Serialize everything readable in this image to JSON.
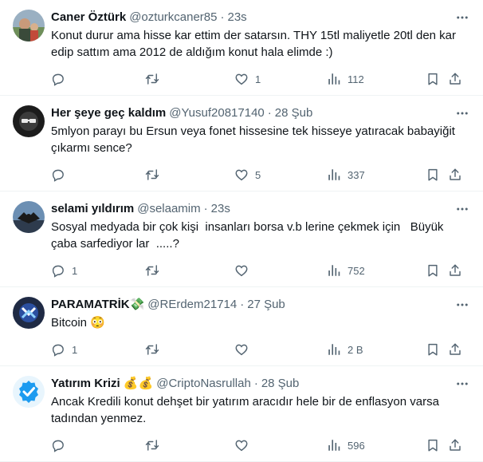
{
  "tweets": [
    {
      "name": "Caner Öztürk",
      "handle": "@ozturkcaner85",
      "dot": "·",
      "time": "23s",
      "text": "Konut durur ama hisse kar ettim der satarsın. THY 15tl maliyetle 20tl den kar edip sattım ama 2012 de aldığım konut hala elimde :)",
      "replies": "",
      "retweets": "",
      "likes": "1",
      "views": "112"
    },
    {
      "name": "Her şeye geç kaldım",
      "handle": "@Yusuf20817140",
      "dot": "·",
      "time": "28 Şub",
      "text": "5mlyon parayı bu Ersun veya fonet hissesine tek hisseye yatıracak babayiğit çıkarmı sence?",
      "replies": "",
      "retweets": "",
      "likes": "5",
      "views": "337"
    },
    {
      "name": "selami yıldırım",
      "handle": "@selaamim",
      "dot": "·",
      "time": "23s",
      "text": "Sosyal medyada bir çok kişi  insanları borsa v.b lerine çekmek için   Büyük çaba sarfediyor lar  .....?",
      "replies": "1",
      "retweets": "",
      "likes": "",
      "views": "752"
    },
    {
      "name": "PARAMATRİK💸",
      "handle": "@RErdem21714",
      "dot": "·",
      "time": "27 Şub",
      "text": "Bitcoin 😳",
      "replies": "1",
      "retweets": "",
      "likes": "",
      "views": "2 B"
    },
    {
      "name": "Yatırım Krizi 💰💰",
      "handle": "@CriptoNasrullah",
      "dot": "·",
      "time": "28 Şub",
      "text": "Ancak Kredili konut dehşet bir yatırım aracıdır hele bir de enflasyon varsa tadından yenmez.",
      "replies": "",
      "retweets": "",
      "likes": "",
      "views": "596"
    }
  ],
  "icons": {
    "more": "more-horizontal-icon",
    "reply": "reply-bubble-icon",
    "retweet": "retweet-icon",
    "like": "heart-icon",
    "views": "views-bar-chart-icon",
    "bookmark": "bookmark-icon",
    "share": "share-upload-icon"
  },
  "colors": {
    "text_primary": "#0f1419",
    "text_secondary": "#536471",
    "divider": "#eff3f4",
    "verified_badge_blue": "#1d9bf0",
    "paramatrik_avatar": "#1f2a44"
  }
}
